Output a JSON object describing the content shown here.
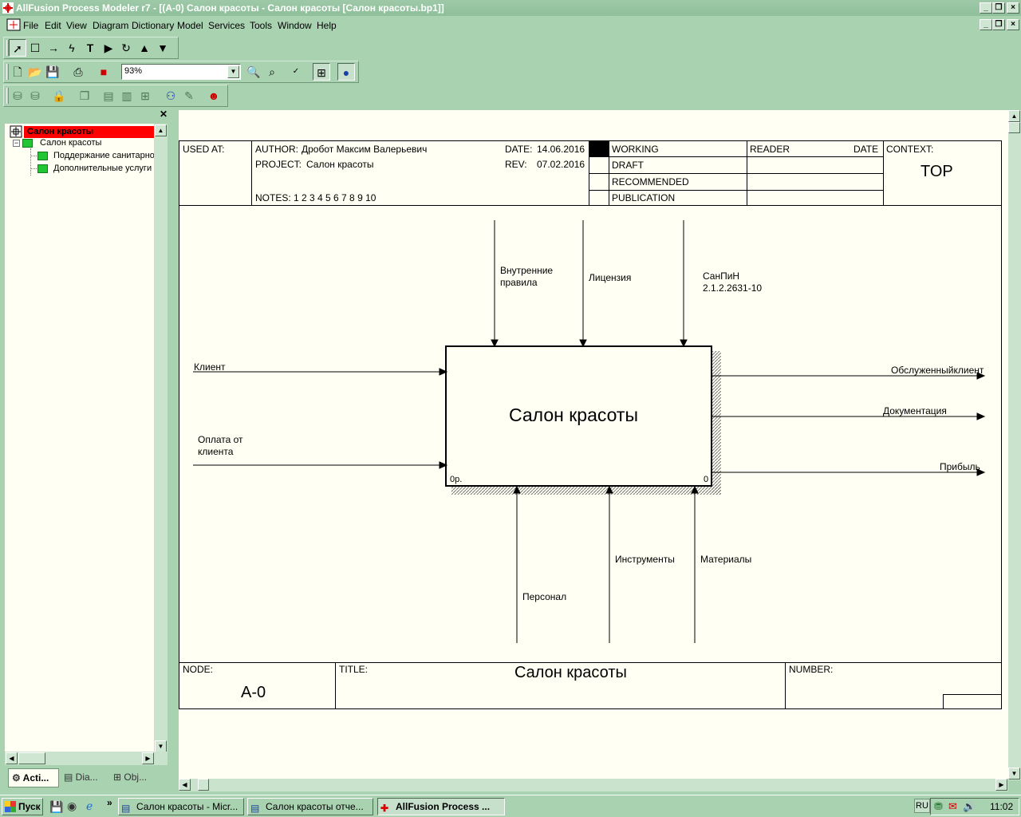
{
  "window": {
    "title": "AllFusion Process Modeler r7 - [(A-0) Салон красоты - Салон красоты  [Салон красоты.bp1]]"
  },
  "menu": [
    "File",
    "Edit",
    "View",
    "Diagram",
    "Dictionary",
    "Model",
    "Services",
    "Tools",
    "Window",
    "Help"
  ],
  "toolbar": {
    "zoom": "93%"
  },
  "tree": {
    "root": "Салон красоты",
    "child": "Салон красоты",
    "items": [
      "Поддержание санитарно",
      "Дополнительные услуги"
    ]
  },
  "panel_tabs": [
    "Acti...",
    "Dia...",
    "Obj..."
  ],
  "diagram": {
    "header": {
      "used_at": "USED AT:",
      "author_label": "AUTHOR:",
      "author": "Дробот Максим Валерьевич",
      "project_label": "PROJECT:",
      "project": "Салон красоты",
      "date_label": "DATE:",
      "date": "14.06.2016",
      "rev_label": "REV:",
      "rev": "07.02.2016",
      "notes": "NOTES:  1  2  3  4  5  6  7  8  9  10",
      "status": [
        "WORKING",
        "DRAFT",
        "RECOMMENDED",
        "PUBLICATION"
      ],
      "reader": "READER",
      "date2": "DATE",
      "context": "CONTEXT:",
      "top": "TOP"
    },
    "box": {
      "title": "Салон красоты",
      "cost": "0р.",
      "number": "0"
    },
    "arrows": {
      "controls": [
        "Внутренние правила",
        "Лицензия",
        "СанПиН 2.1.2.2631-10"
      ],
      "inputs": [
        "Клиент",
        "Оплата от клиента"
      ],
      "outputs": [
        "Обслуженныйклиент",
        "Документация",
        "Прибыль"
      ],
      "mechanisms": [
        "Персонал",
        "Инструменты",
        "Материалы"
      ]
    },
    "footer": {
      "node_label": "NODE:",
      "node": "A-0",
      "title_label": "TITLE:",
      "title": "Салон красоты",
      "number_label": "NUMBER:"
    }
  },
  "taskbar": {
    "start": "Пуск",
    "tasks": [
      "Салон красоты - Micr...",
      "Салон красоты отче...",
      "AllFusion Process ..."
    ],
    "lang": "RU",
    "clock": "11:02"
  }
}
